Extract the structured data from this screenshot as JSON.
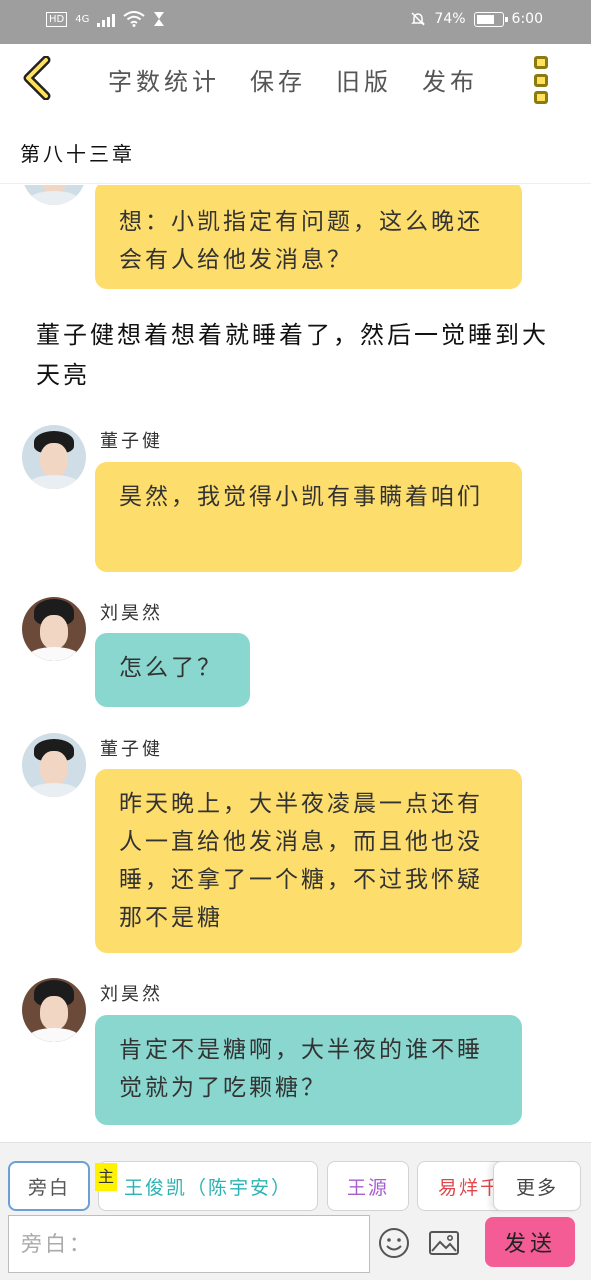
{
  "status_bar": {
    "left_badge": "HD",
    "network": "4G",
    "battery_text": "74%",
    "battery_level": 0.74,
    "time": "6:00"
  },
  "toolbar": {
    "back_icon": "chevron-left-icon",
    "items": [
      "字数统计",
      "保存",
      "旧版",
      "发布"
    ],
    "more_icon": "more-vertical-icon",
    "accent_color": "#ffe15a"
  },
  "chapter_title": "第八十三章",
  "messages": [
    {
      "kind": "bubble",
      "color": "yellow",
      "speaker": "",
      "text": "想：小凯指定有问题，这么晚还会有人给他发消息？"
    },
    {
      "kind": "narration",
      "text": "董子健想着想着就睡着了，然后一觉睡到大天亮"
    },
    {
      "kind": "bubble",
      "color": "yellow",
      "speaker": "董子健",
      "text": "昊然，我觉得小凯有事瞒着咱们"
    },
    {
      "kind": "bubble",
      "color": "green",
      "speaker": "刘昊然",
      "text": "怎么了？"
    },
    {
      "kind": "bubble",
      "color": "yellow",
      "speaker": "董子健",
      "text": "昨天晚上，大半夜凌晨一点还有人一直给他发消息，而且他也没睡，还拿了一个糖，不过我怀疑那不是糖"
    },
    {
      "kind": "bubble",
      "color": "green",
      "speaker": "刘昊然",
      "text": "肯定不是糖啊，大半夜的谁不睡觉就为了吃颗糖？"
    }
  ],
  "roles": [
    {
      "label": "旁白",
      "color": "#555555",
      "active": true
    },
    {
      "label": "王俊凯（陈宇安）",
      "color": "#2bb3b3",
      "active": false,
      "tag": "主"
    },
    {
      "label": "王源",
      "color": "#a65ed1",
      "active": false
    },
    {
      "label": "易烊千玺",
      "color": "#e0474c",
      "active": false
    },
    {
      "label": "更多",
      "color": "#444444",
      "active": false
    }
  ],
  "composer": {
    "placeholder": "旁白：",
    "emoji_icon": "emoji-icon",
    "image_icon": "image-icon",
    "send_label": "发送"
  }
}
